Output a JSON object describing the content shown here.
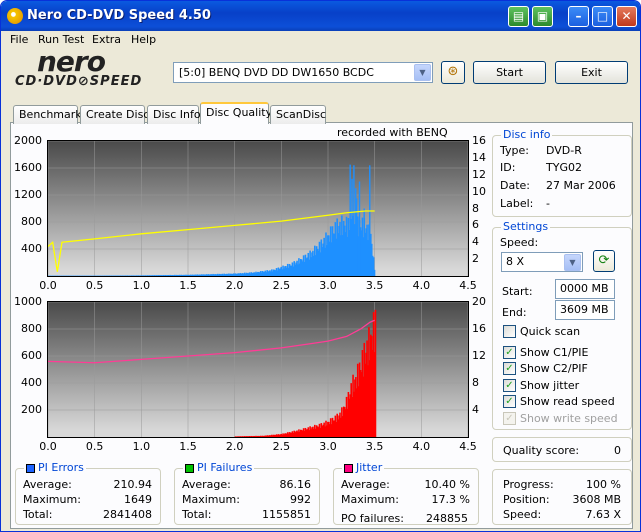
{
  "window": {
    "title": "Nero CD-DVD Speed 4.50"
  },
  "menu": [
    "File",
    "Run Test",
    "Extra",
    "Help"
  ],
  "logo": {
    "word": "nero",
    "sub": "CD·DVD⊘SPEED"
  },
  "drive": {
    "selected": "[5:0]  BENQ DVD DD DW1650 BCDC"
  },
  "buttons": {
    "start": "Start",
    "exit": "Exit"
  },
  "tabs": [
    {
      "label": "Benchmark",
      "active": false
    },
    {
      "label": "Create Disc",
      "active": false
    },
    {
      "label": "Disc Info",
      "active": false
    },
    {
      "label": "Disc Quality",
      "active": true
    },
    {
      "label": "ScanDisc",
      "active": false
    }
  ],
  "chart_data": [
    {
      "type": "bar",
      "title": "recorded with BENQ",
      "x_ticks": [
        "0.0",
        "0.5",
        "1.0",
        "1.5",
        "2.0",
        "2.5",
        "3.0",
        "3.5",
        "4.0",
        "4.5"
      ],
      "y_ticks": [
        "2000",
        "1600",
        "1200",
        "800",
        "400"
      ],
      "y2_ticks": [
        "16",
        "14",
        "12",
        "10",
        "8",
        "6",
        "4",
        "2"
      ],
      "xlim": [
        0,
        4.5
      ],
      "ylim": [
        0,
        2000
      ],
      "y2lim": [
        0,
        16
      ],
      "series": [
        {
          "type": "bar",
          "color": "#1e90ff",
          "x": [
            0.0,
            0.5,
            1.0,
            1.5,
            2.0,
            2.2,
            2.4,
            2.6,
            2.7,
            2.8,
            2.9,
            3.0,
            3.05,
            3.1,
            3.15,
            3.2,
            3.25,
            3.3,
            3.35,
            3.4,
            3.45,
            3.5
          ],
          "values": [
            5,
            5,
            10,
            20,
            40,
            60,
            100,
            200,
            280,
            380,
            520,
            700,
            800,
            880,
            900,
            890,
            900,
            880,
            900,
            860,
            700,
            0
          ]
        },
        {
          "type": "line",
          "color": "#ffff00",
          "axis": "right",
          "x": [
            0.0,
            0.05,
            0.1,
            0.15,
            0.5,
            1.0,
            1.5,
            2.0,
            2.5,
            3.0,
            3.2,
            3.4,
            3.5
          ],
          "values": [
            3.5,
            4.0,
            0.5,
            4.0,
            4.4,
            5.0,
            5.5,
            6.0,
            6.5,
            7.2,
            7.5,
            7.7,
            7.7
          ]
        }
      ],
      "spikes": {
        "x": [
          3.23,
          3.25,
          3.27,
          3.29,
          3.3,
          3.33,
          3.38,
          3.44
        ],
        "values": [
          1650,
          1440,
          1640,
          1300,
          1150,
          1400,
          1000,
          1640
        ]
      }
    },
    {
      "type": "bar",
      "x_ticks": [
        "0.0",
        "0.5",
        "1.0",
        "1.5",
        "2.0",
        "2.5",
        "3.0",
        "3.5",
        "4.0",
        "4.5"
      ],
      "y_ticks": [
        "1000",
        "800",
        "600",
        "400",
        "200"
      ],
      "y2_ticks": [
        "20",
        "16",
        "12",
        "8",
        "4"
      ],
      "xlim": [
        0,
        4.5
      ],
      "ylim": [
        0,
        1000
      ],
      "y2lim": [
        0,
        20
      ],
      "series": [
        {
          "type": "bar",
          "color": "#ff0000",
          "x": [
            2.0,
            2.3,
            2.5,
            2.7,
            2.8,
            2.9,
            3.0,
            3.1,
            3.15,
            3.2,
            3.25,
            3.3,
            3.35,
            3.4,
            3.45,
            3.5
          ],
          "values": [
            5,
            10,
            25,
            60,
            80,
            100,
            130,
            180,
            230,
            320,
            450,
            520,
            640,
            760,
            850,
            990
          ]
        },
        {
          "type": "line",
          "color": "#ff3c96",
          "axis": "right",
          "x": [
            0.0,
            0.5,
            1.0,
            1.5,
            2.0,
            2.5,
            2.8,
            3.0,
            3.2,
            3.35,
            3.45,
            3.5
          ],
          "values": [
            11.2,
            11.0,
            11.5,
            12.0,
            12.5,
            13.2,
            13.8,
            14.2,
            14.9,
            16.0,
            17.0,
            17.3
          ]
        }
      ]
    }
  ],
  "stats": {
    "pi_errors": {
      "title": "PI Errors",
      "color": "#1e64ff",
      "average_label": "Average:",
      "average": "210.94",
      "maximum_label": "Maximum:",
      "maximum": "1649",
      "total_label": "Total:",
      "total": "2841408"
    },
    "pi_failures": {
      "title": "PI Failures",
      "color": "#00c000",
      "average_label": "Average:",
      "average": "86.16",
      "maximum_label": "Maximum:",
      "maximum": "992",
      "total_label": "Total:",
      "total": "1155851"
    },
    "jitter": {
      "title": "Jitter",
      "color": "#ff0080",
      "average_label": "Average:",
      "average": "10.40 %",
      "maximum_label": "Maximum:",
      "maximum": "17.3 %",
      "po_label": "PO failures:",
      "po": "248855"
    }
  },
  "disc_info": {
    "title": "Disc info",
    "type_label": "Type:",
    "type": "DVD-R",
    "id_label": "ID:",
    "id": "TYG02",
    "date_label": "Date:",
    "date": "27 Mar 2006",
    "label_label": "Label:",
    "label": "-"
  },
  "settings": {
    "title": "Settings",
    "speed_label": "Speed:",
    "speed": "8 X",
    "start_label": "Start:",
    "start": "0000 MB",
    "end_label": "End:",
    "end": "3609 MB",
    "quick_scan": "Quick scan",
    "show_c1": "Show C1/PIE",
    "show_c2": "Show C2/PIF",
    "show_jitter": "Show jitter",
    "show_read": "Show read speed",
    "show_write": "Show write speed"
  },
  "quality": {
    "label": "Quality score:",
    "value": "0"
  },
  "progress": {
    "progress_label": "Progress:",
    "progress": "100 %",
    "position_label": "Position:",
    "position": "3608 MB",
    "speed_label": "Speed:",
    "speed": "7.63 X"
  }
}
